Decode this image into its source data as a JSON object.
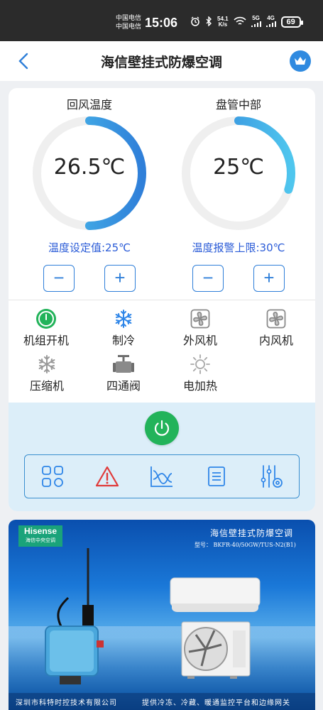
{
  "status_bar": {
    "carrier_1": "中国电信",
    "carrier_2": "中国电信",
    "time": "15:06",
    "speed_value": "54.1",
    "speed_unit": "K/s",
    "net1": "5G",
    "net2": "4G",
    "battery": "69"
  },
  "header": {
    "title": "海信壁挂式防爆空调"
  },
  "gauges": [
    {
      "label": "回风温度",
      "value": "26.5℃",
      "fill": 0.5,
      "setting": "温度设定值:25℃"
    },
    {
      "label": "盘管中部",
      "value": "25℃",
      "fill": 0.3,
      "setting": "温度报警上限:30℃"
    }
  ],
  "steppers": {
    "minus": "−",
    "plus": "+"
  },
  "status_items": [
    {
      "label": "机组开机",
      "icon": "power-on-icon",
      "active": true
    },
    {
      "label": "制冷",
      "icon": "snowflake-icon",
      "active": true
    },
    {
      "label": "外风机",
      "icon": "fan-icon",
      "active": false
    },
    {
      "label": "内风机",
      "icon": "fan-icon",
      "active": false
    },
    {
      "label": "压缩机",
      "icon": "snowflake-icon",
      "active": false
    },
    {
      "label": "四通阀",
      "icon": "valve-icon",
      "active": false
    },
    {
      "label": "电加热",
      "icon": "sun-icon",
      "active": false
    }
  ],
  "toolbar": [
    "grid-apps-icon",
    "warning-icon",
    "chart-curve-icon",
    "list-document-icon",
    "settings-sliders-icon"
  ],
  "banner": {
    "brand": "Hisense",
    "brand_sub": "海信中央空调",
    "title": "海信壁挂式防爆空调",
    "model": "型号： BKFR-40/50GW/TUS-N2(B1)",
    "footer_left": "深圳市科特时控技术有限公司",
    "footer_right": "提供冷冻、冷藏、暖通监控平台和边缘网关"
  },
  "colors": {
    "accent_blue": "#2f7fd9",
    "setting_text": "#2a5bd7",
    "power_green": "#22b35a",
    "active_blue": "#2f86e8",
    "inactive_gray": "#8a8a8a",
    "warning_red": "#e03a3a"
  }
}
